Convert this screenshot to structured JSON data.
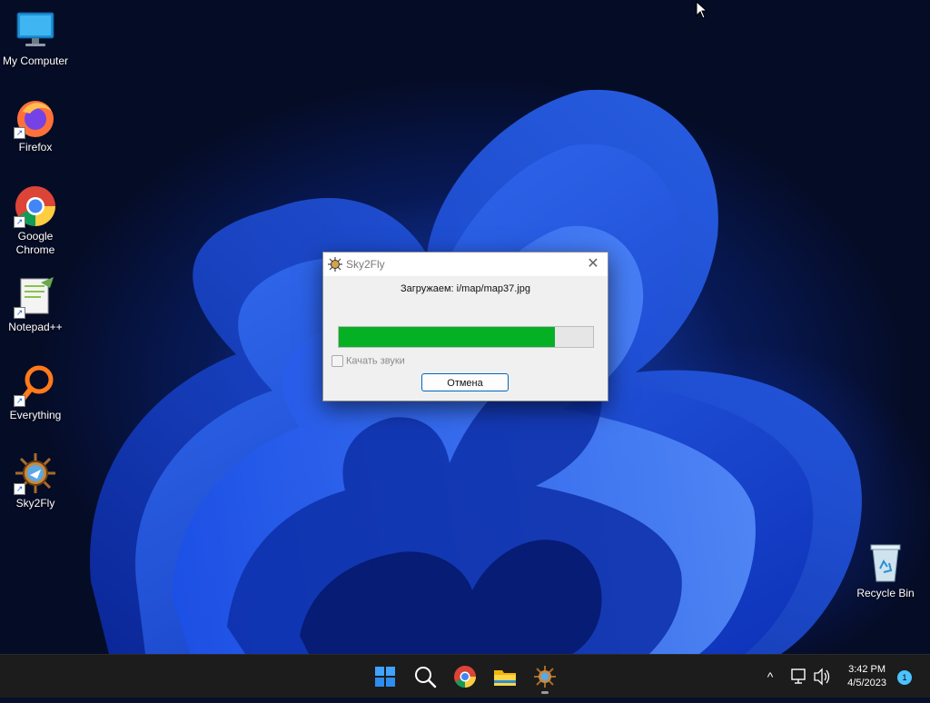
{
  "desktop": {
    "icons": [
      {
        "label": "My Computer"
      },
      {
        "label": "Firefox"
      },
      {
        "label": "Google Chrome"
      },
      {
        "label": "Notepad++"
      },
      {
        "label": "Everything"
      },
      {
        "label": "Sky2Fly"
      },
      {
        "label": "Recycle Bin"
      }
    ]
  },
  "dialog": {
    "title": "Sky2Fly",
    "status": "Загружаем: i/map/map37.jpg",
    "progress": 0.85,
    "checkbox_label": "Качать звуки",
    "cancel_label": "Отмена",
    "close_glyph": "✕"
  },
  "taskbar": {
    "apps": [
      "start-icon",
      "search-icon",
      "chrome-icon",
      "file-explorer-icon",
      "sky2fly-icon"
    ],
    "tray_arrow": "^",
    "time": "3:42 PM",
    "date": "4/5/2023",
    "notification_count": "1"
  },
  "colors": {
    "progress_fill": "#06b025",
    "taskbar_bg": "#1c1c1c",
    "accent": "#0067c0"
  }
}
